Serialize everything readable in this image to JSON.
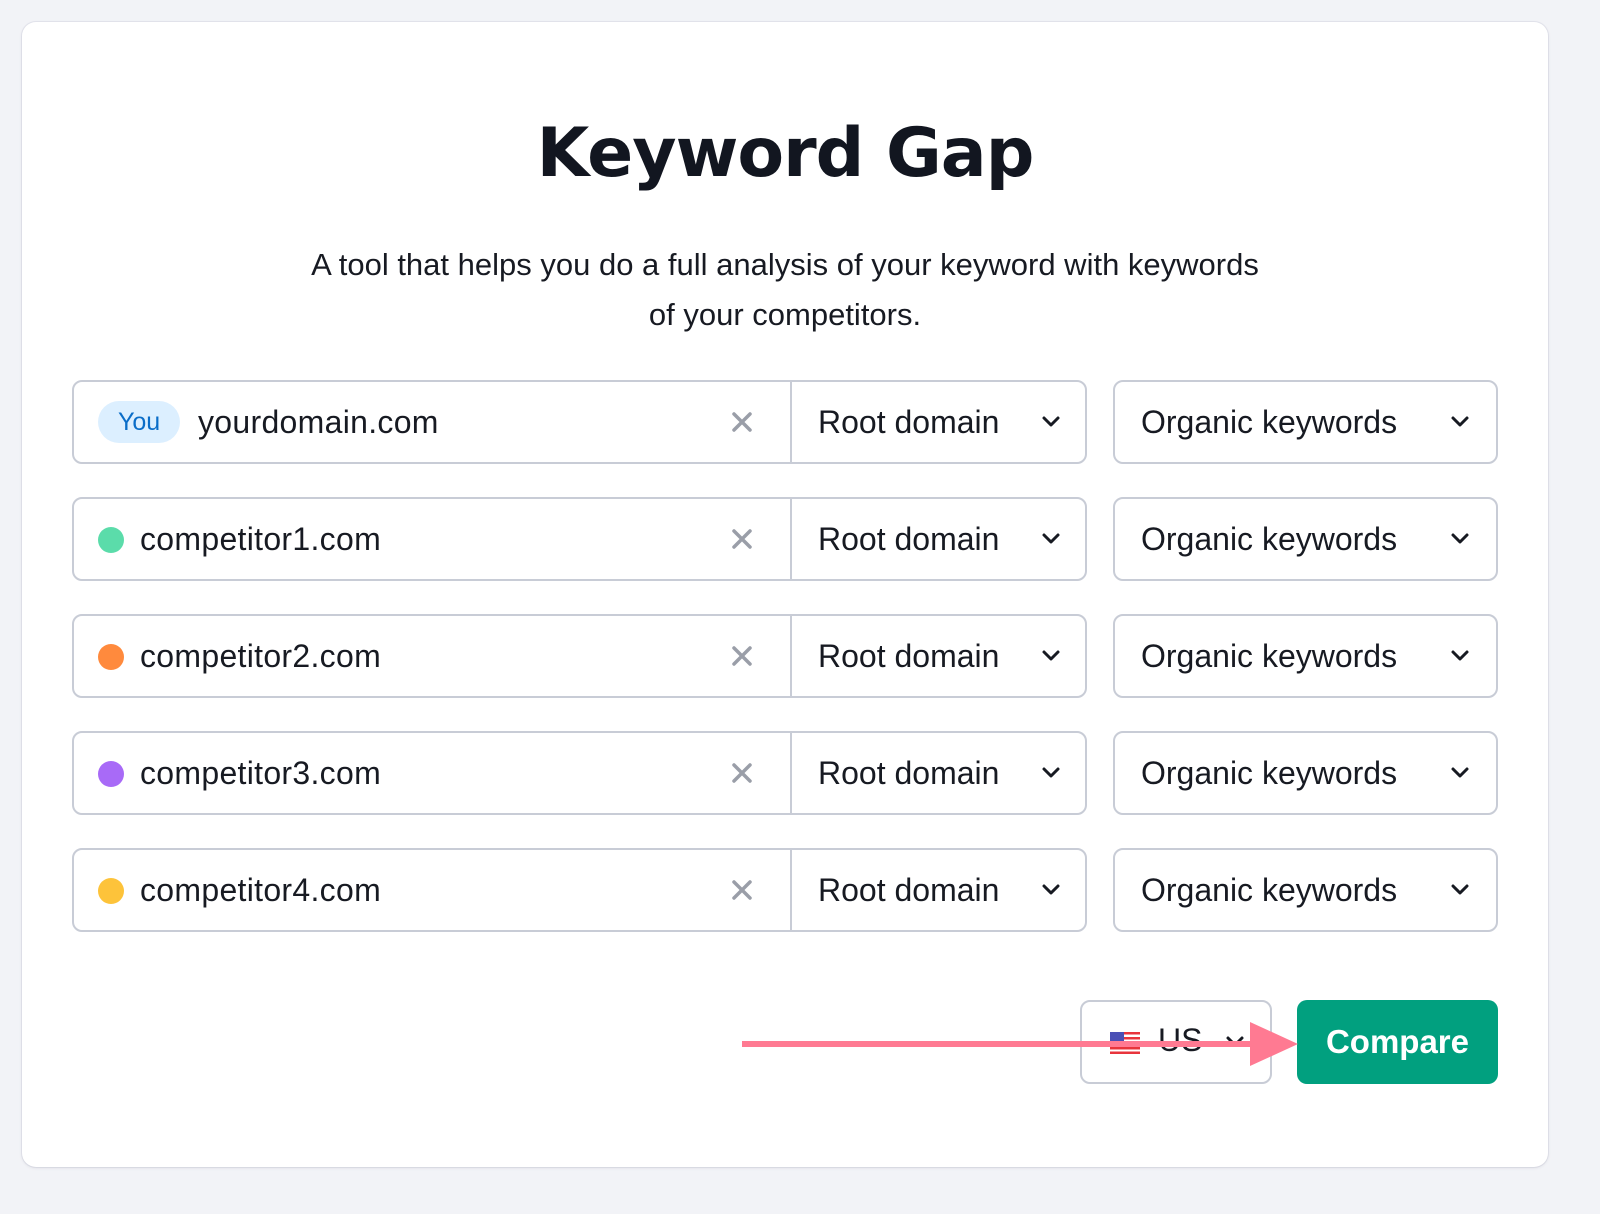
{
  "page": {
    "title": "Keyword Gap",
    "subtitle_line1": "A tool that helps you do a full analysis of your keyword with keywords",
    "subtitle_line2": "of your competitors."
  },
  "rows": [
    {
      "badge": "You",
      "domain": "yourdomain.com",
      "dot_color": null,
      "scope": "Root domain",
      "keyword_type": "Organic keywords",
      "clear_icon": "close-icon"
    },
    {
      "badge": null,
      "domain": "competitor1.com",
      "dot_color": "#5bdcaa",
      "scope": "Root domain",
      "keyword_type": "Organic keywords",
      "clear_icon": "close-icon"
    },
    {
      "badge": null,
      "domain": "competitor2.com",
      "dot_color": "#ff8a3d",
      "scope": "Root domain",
      "keyword_type": "Organic keywords",
      "clear_icon": "close-icon"
    },
    {
      "badge": null,
      "domain": "competitor3.com",
      "dot_color": "#a86af7",
      "scope": "Root domain",
      "keyword_type": "Organic keywords",
      "clear_icon": "close-icon"
    },
    {
      "badge": null,
      "domain": "competitor4.com",
      "dot_color": "#fdc33a",
      "scope": "Root domain",
      "keyword_type": "Organic keywords",
      "clear_icon": "close-icon"
    }
  ],
  "database": {
    "label": "US",
    "flag_icon": "us-flag-icon"
  },
  "compare_button": {
    "label": "Compare",
    "color": "#01a07f"
  },
  "annotation": {
    "arrow_color": "#ff7a92",
    "arrow_icon": "arrow-right-icon"
  },
  "colors": {
    "badge_bg": "#dcefff",
    "badge_text": "#0a6dc8",
    "border": "#c8ccd6",
    "background": "#f2f3f7"
  }
}
